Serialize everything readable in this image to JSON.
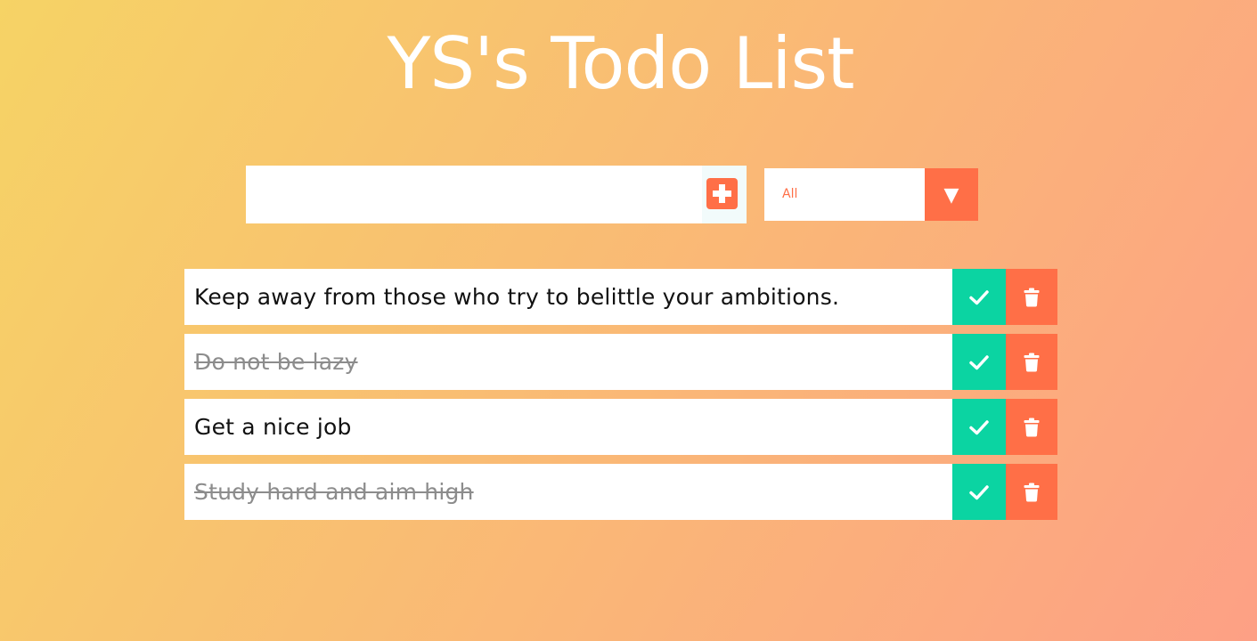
{
  "header": {
    "title": "YS's Todo List"
  },
  "form": {
    "input_value": "",
    "input_placeholder": "",
    "add_icon": "plus-square-icon",
    "filter": {
      "selected": "All",
      "options": [
        "All"
      ],
      "arrow_glyph": "▼"
    }
  },
  "todos": [
    {
      "text": "Keep away from those who try to belittle your ambitions.",
      "completed": false
    },
    {
      "text": "Do not be lazy",
      "completed": true
    },
    {
      "text": "Get a nice job",
      "completed": false
    },
    {
      "text": "Study hard and aim high",
      "completed": true
    }
  ],
  "icons": {
    "complete": "check-icon",
    "delete": "trash-icon"
  },
  "colors": {
    "gradient_start": "#f6d365",
    "gradient_end": "#fda085",
    "accent": "#ff6f47",
    "complete": "#0bd4a2",
    "white": "#ffffff",
    "completed_text": "#808080"
  }
}
